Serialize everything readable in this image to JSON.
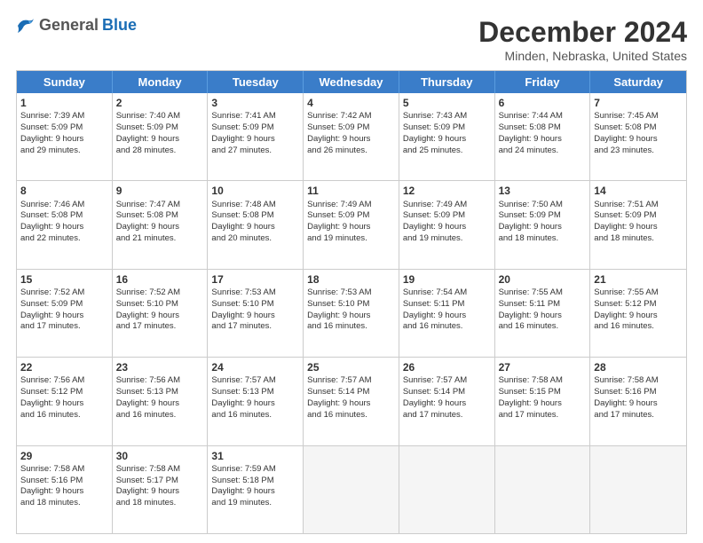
{
  "logo": {
    "general": "General",
    "blue": "Blue"
  },
  "title": "December 2024",
  "subtitle": "Minden, Nebraska, United States",
  "header_days": [
    "Sunday",
    "Monday",
    "Tuesday",
    "Wednesday",
    "Thursday",
    "Friday",
    "Saturday"
  ],
  "weeks": [
    [
      {
        "day": "1",
        "info": "Sunrise: 7:39 AM\nSunset: 5:09 PM\nDaylight: 9 hours\nand 29 minutes."
      },
      {
        "day": "2",
        "info": "Sunrise: 7:40 AM\nSunset: 5:09 PM\nDaylight: 9 hours\nand 28 minutes."
      },
      {
        "day": "3",
        "info": "Sunrise: 7:41 AM\nSunset: 5:09 PM\nDaylight: 9 hours\nand 27 minutes."
      },
      {
        "day": "4",
        "info": "Sunrise: 7:42 AM\nSunset: 5:09 PM\nDaylight: 9 hours\nand 26 minutes."
      },
      {
        "day": "5",
        "info": "Sunrise: 7:43 AM\nSunset: 5:09 PM\nDaylight: 9 hours\nand 25 minutes."
      },
      {
        "day": "6",
        "info": "Sunrise: 7:44 AM\nSunset: 5:08 PM\nDaylight: 9 hours\nand 24 minutes."
      },
      {
        "day": "7",
        "info": "Sunrise: 7:45 AM\nSunset: 5:08 PM\nDaylight: 9 hours\nand 23 minutes."
      }
    ],
    [
      {
        "day": "8",
        "info": "Sunrise: 7:46 AM\nSunset: 5:08 PM\nDaylight: 9 hours\nand 22 minutes."
      },
      {
        "day": "9",
        "info": "Sunrise: 7:47 AM\nSunset: 5:08 PM\nDaylight: 9 hours\nand 21 minutes."
      },
      {
        "day": "10",
        "info": "Sunrise: 7:48 AM\nSunset: 5:08 PM\nDaylight: 9 hours\nand 20 minutes."
      },
      {
        "day": "11",
        "info": "Sunrise: 7:49 AM\nSunset: 5:09 PM\nDaylight: 9 hours\nand 19 minutes."
      },
      {
        "day": "12",
        "info": "Sunrise: 7:49 AM\nSunset: 5:09 PM\nDaylight: 9 hours\nand 19 minutes."
      },
      {
        "day": "13",
        "info": "Sunrise: 7:50 AM\nSunset: 5:09 PM\nDaylight: 9 hours\nand 18 minutes."
      },
      {
        "day": "14",
        "info": "Sunrise: 7:51 AM\nSunset: 5:09 PM\nDaylight: 9 hours\nand 18 minutes."
      }
    ],
    [
      {
        "day": "15",
        "info": "Sunrise: 7:52 AM\nSunset: 5:09 PM\nDaylight: 9 hours\nand 17 minutes."
      },
      {
        "day": "16",
        "info": "Sunrise: 7:52 AM\nSunset: 5:10 PM\nDaylight: 9 hours\nand 17 minutes."
      },
      {
        "day": "17",
        "info": "Sunrise: 7:53 AM\nSunset: 5:10 PM\nDaylight: 9 hours\nand 17 minutes."
      },
      {
        "day": "18",
        "info": "Sunrise: 7:53 AM\nSunset: 5:10 PM\nDaylight: 9 hours\nand 16 minutes."
      },
      {
        "day": "19",
        "info": "Sunrise: 7:54 AM\nSunset: 5:11 PM\nDaylight: 9 hours\nand 16 minutes."
      },
      {
        "day": "20",
        "info": "Sunrise: 7:55 AM\nSunset: 5:11 PM\nDaylight: 9 hours\nand 16 minutes."
      },
      {
        "day": "21",
        "info": "Sunrise: 7:55 AM\nSunset: 5:12 PM\nDaylight: 9 hours\nand 16 minutes."
      }
    ],
    [
      {
        "day": "22",
        "info": "Sunrise: 7:56 AM\nSunset: 5:12 PM\nDaylight: 9 hours\nand 16 minutes."
      },
      {
        "day": "23",
        "info": "Sunrise: 7:56 AM\nSunset: 5:13 PM\nDaylight: 9 hours\nand 16 minutes."
      },
      {
        "day": "24",
        "info": "Sunrise: 7:57 AM\nSunset: 5:13 PM\nDaylight: 9 hours\nand 16 minutes."
      },
      {
        "day": "25",
        "info": "Sunrise: 7:57 AM\nSunset: 5:14 PM\nDaylight: 9 hours\nand 16 minutes."
      },
      {
        "day": "26",
        "info": "Sunrise: 7:57 AM\nSunset: 5:14 PM\nDaylight: 9 hours\nand 17 minutes."
      },
      {
        "day": "27",
        "info": "Sunrise: 7:58 AM\nSunset: 5:15 PM\nDaylight: 9 hours\nand 17 minutes."
      },
      {
        "day": "28",
        "info": "Sunrise: 7:58 AM\nSunset: 5:16 PM\nDaylight: 9 hours\nand 17 minutes."
      }
    ],
    [
      {
        "day": "29",
        "info": "Sunrise: 7:58 AM\nSunset: 5:16 PM\nDaylight: 9 hours\nand 18 minutes."
      },
      {
        "day": "30",
        "info": "Sunrise: 7:58 AM\nSunset: 5:17 PM\nDaylight: 9 hours\nand 18 minutes."
      },
      {
        "day": "31",
        "info": "Sunrise: 7:59 AM\nSunset: 5:18 PM\nDaylight: 9 hours\nand 19 minutes."
      },
      {
        "day": "",
        "info": ""
      },
      {
        "day": "",
        "info": ""
      },
      {
        "day": "",
        "info": ""
      },
      {
        "day": "",
        "info": ""
      }
    ]
  ]
}
